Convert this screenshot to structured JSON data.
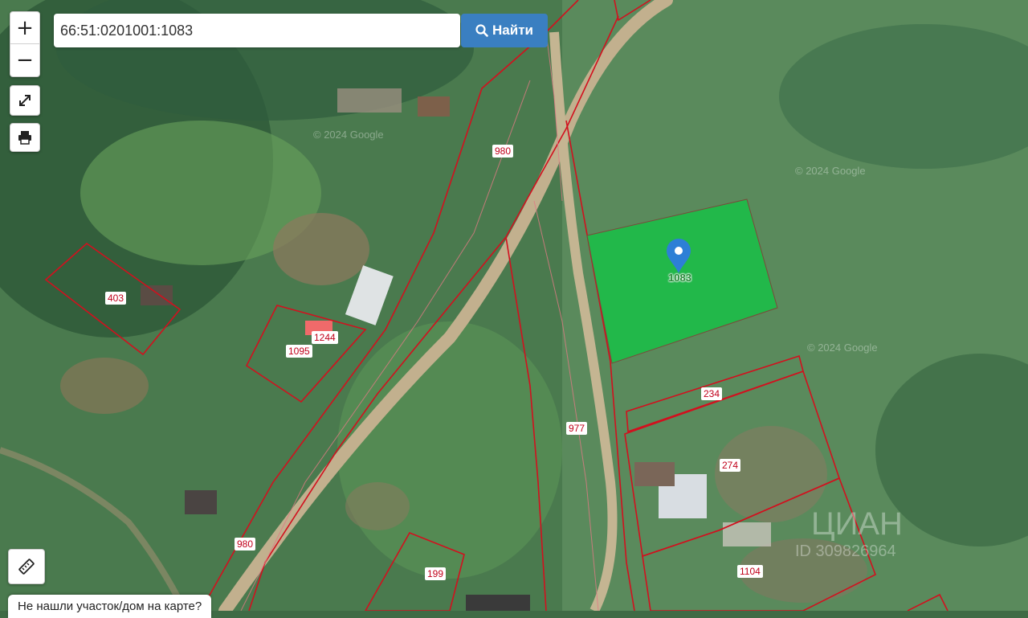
{
  "search": {
    "value": "66:51:0201001:1083",
    "button_label": "Найти"
  },
  "controls": {
    "zoom_in": "+",
    "zoom_out": "−"
  },
  "selected_parcel": {
    "label": "1083",
    "color": "#22b84a"
  },
  "parcel_labels": {
    "p980_top": "980",
    "p980_bottom": "980",
    "p977": "977",
    "p403": "403",
    "p1244": "1244",
    "p1095": "1095",
    "p234": "234",
    "p274": "274",
    "p1104": "1104",
    "p199": "199"
  },
  "watermarks": {
    "w1": "© 2024 Google",
    "w2": "© 2024 Google",
    "w3": "© 2024 Google",
    "w4": "ЦИАН",
    "w5": "ID 309826964"
  },
  "footer": {
    "not_found": "Не нашли участок/дом на карте?"
  },
  "colors": {
    "boundary": "#d2101e",
    "accent": "#3a7fc1",
    "parcel_fill": "#22b84a"
  }
}
